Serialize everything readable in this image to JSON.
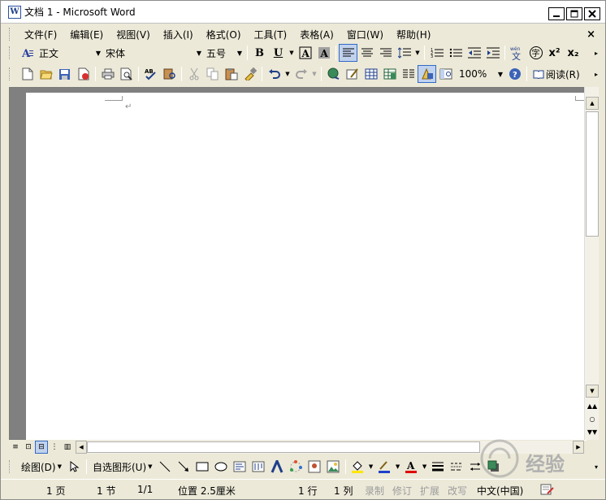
{
  "window": {
    "title": "文档 1 - Microsoft Word"
  },
  "menu": [
    "文件(F)",
    "编辑(E)",
    "视图(V)",
    "插入(I)",
    "格式(O)",
    "工具(T)",
    "表格(A)",
    "窗口(W)",
    "帮助(H)"
  ],
  "formatting": {
    "style": "正文",
    "font": "宋体",
    "size": "五号",
    "bold_label": "B",
    "underline_label": "U",
    "superscript_label": "x²",
    "subscript_label": "x₂"
  },
  "standard": {
    "zoom": "100%",
    "read_label": "阅读(R)"
  },
  "drawing": {
    "draw_label": "绘图(D)",
    "autoshapes_label": "自选图形(U)",
    "font_color_letter": "A"
  },
  "status": {
    "page": "1 页",
    "section": "1 节",
    "page_of": "1/1",
    "position": "位置 2.5厘米",
    "line": "1 行",
    "column": "1 列",
    "rec": "录制",
    "trk": "修订",
    "ext": "扩展",
    "ovr": "改写",
    "language": "中文(中国)"
  },
  "watermark": "经验",
  "colors": {
    "active_blue": "#316AC5",
    "highlight_yellow": "#FFE600",
    "font_red": "#E00000",
    "highlighter_blue": "#1E3FC8"
  }
}
